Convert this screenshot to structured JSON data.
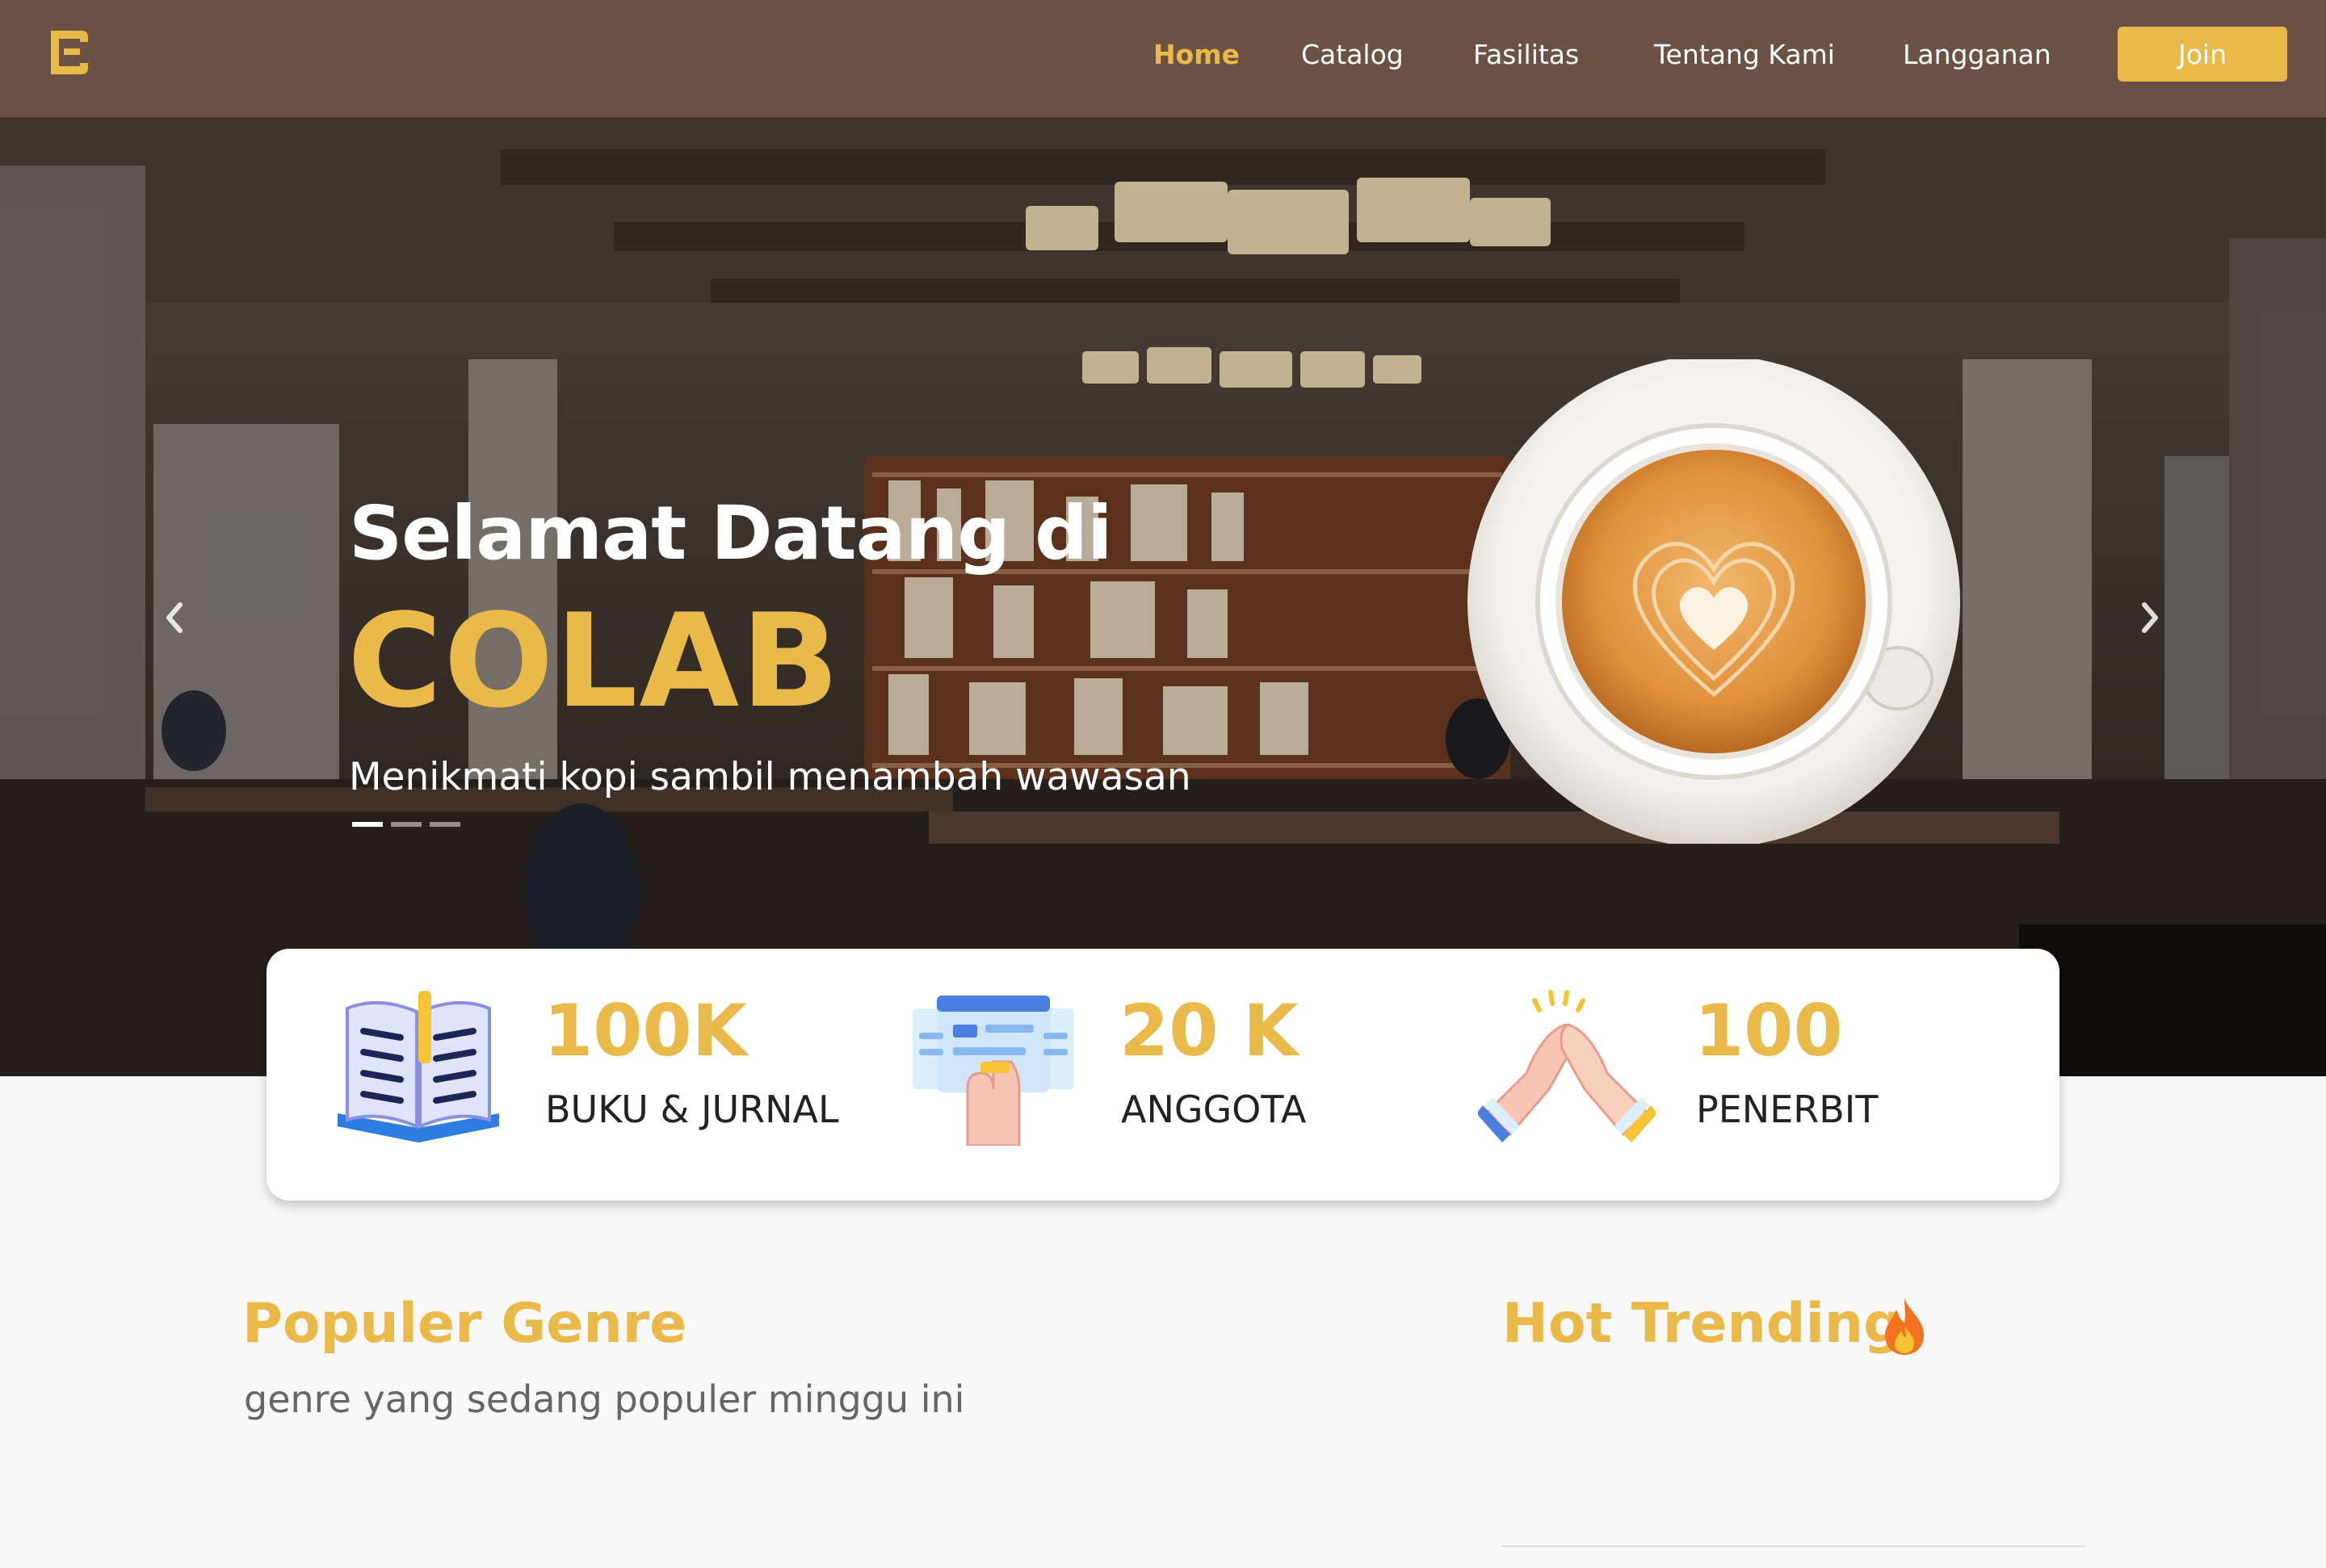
{
  "navbar": {
    "logo": "colab-logo-icon",
    "items": [
      {
        "label": "Home",
        "active": true
      },
      {
        "label": "Catalog",
        "active": false
      },
      {
        "label": "Fasilitas",
        "active": false
      },
      {
        "label": "Tentang Kami",
        "active": false
      },
      {
        "label": "Langganan",
        "active": false
      }
    ],
    "join_label": "Join"
  },
  "hero": {
    "title": "Selamat Datang di",
    "brand": "COLAB",
    "subtitle": "Menikmati kopi sambil menambah wawasan",
    "slides_count": 3,
    "active_slide": 1,
    "prev_icon": "chevron-left-icon",
    "next_icon": "chevron-right-icon",
    "image": "coffee-cup-latte-art"
  },
  "stats": [
    {
      "value": "100K",
      "label": "BUKU & JURNAL",
      "icon": "open-book-icon"
    },
    {
      "value": "20 K",
      "label": "ANGGOTA",
      "icon": "touch-screen-icon"
    },
    {
      "value": "100",
      "label": "PENERBIT",
      "icon": "handshake-icon"
    }
  ],
  "popular_genre": {
    "title": "Populer Genre",
    "subtitle": "genre yang sedang populer minggu ini"
  },
  "hot_trending": {
    "title": "Hot Trending",
    "icon": "fire-icon"
  },
  "colors": {
    "navbar_bg": "#6b5244",
    "accent": "#e9b949",
    "page_bg": "#f8f8f8"
  }
}
